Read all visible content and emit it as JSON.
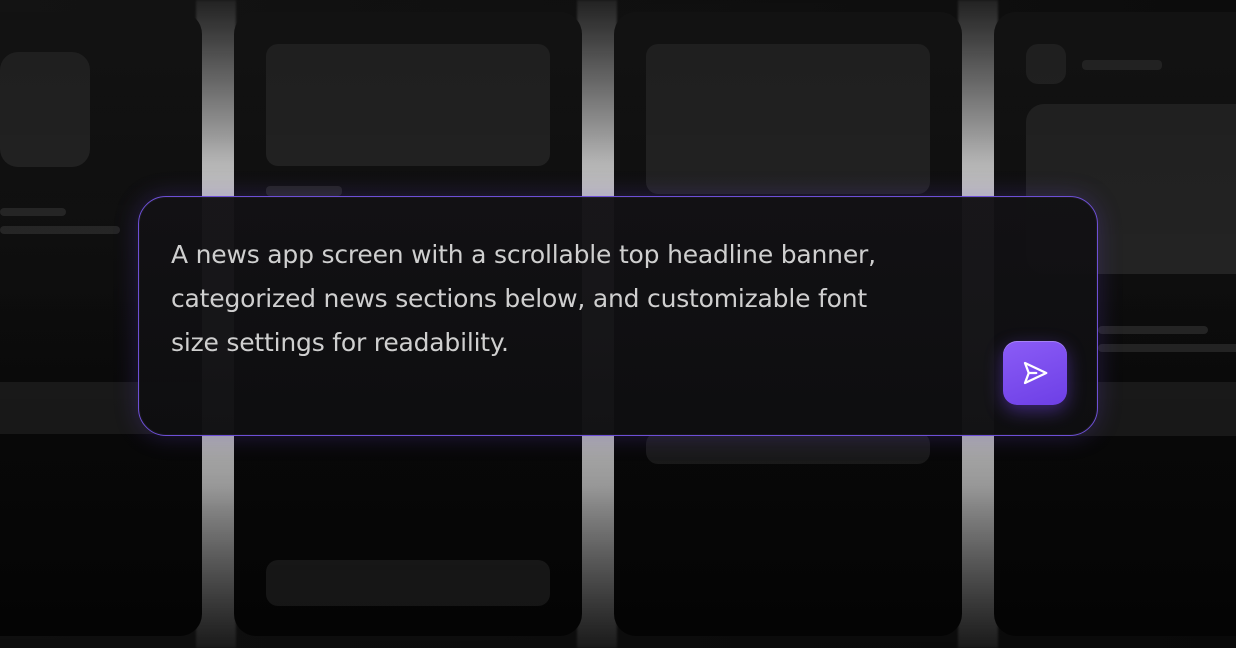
{
  "prompt": {
    "text": "A news app screen with a scrollable top headline banner,\ncategorized news sections below, and customizable font\nsize settings for readability."
  },
  "send_button": {
    "icon": "send-icon"
  },
  "colors": {
    "accent": "#7c4dff",
    "card_border": "#6d4fd6",
    "background": "#0e0e0e",
    "text": "#cfcfcf"
  }
}
